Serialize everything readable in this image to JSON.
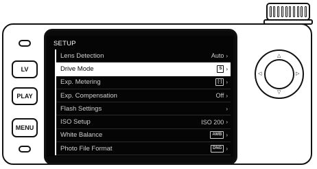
{
  "buttons": {
    "lv": "LV",
    "play": "PLAY",
    "menu": "MENU"
  },
  "menu": {
    "title": "SETUP",
    "items": [
      {
        "label": "Lens Detection",
        "value": "Auto",
        "value_style": "text",
        "selected": false
      },
      {
        "label": "Drive Mode",
        "value": "S",
        "value_style": "box",
        "selected": true
      },
      {
        "label": "Exp. Metering",
        "value": "[·]",
        "value_style": "box",
        "selected": false
      },
      {
        "label": "Exp. Compensation",
        "value": "Off",
        "value_style": "text",
        "selected": false
      },
      {
        "label": "Flash Settings",
        "value": "",
        "value_style": "none",
        "selected": false
      },
      {
        "label": "ISO Setup",
        "value": "ISO 200",
        "value_style": "text",
        "selected": false
      },
      {
        "label": "White Balance",
        "value": "AWB",
        "value_style": "box",
        "selected": false
      },
      {
        "label": "Photo File Format",
        "value": "DNG",
        "value_style": "box",
        "selected": false
      }
    ]
  },
  "icons": {
    "chevron": "chevron-right-icon",
    "nav_up": "triangle-up-icon",
    "nav_down": "triangle-down-icon",
    "nav_left": "triangle-left-icon",
    "nav_right": "triangle-right-icon"
  },
  "colors": {
    "screen_bg": "#050505",
    "menu_text": "#d0d0d0",
    "selected_bg": "#ffffff",
    "selected_text": "#000000"
  }
}
